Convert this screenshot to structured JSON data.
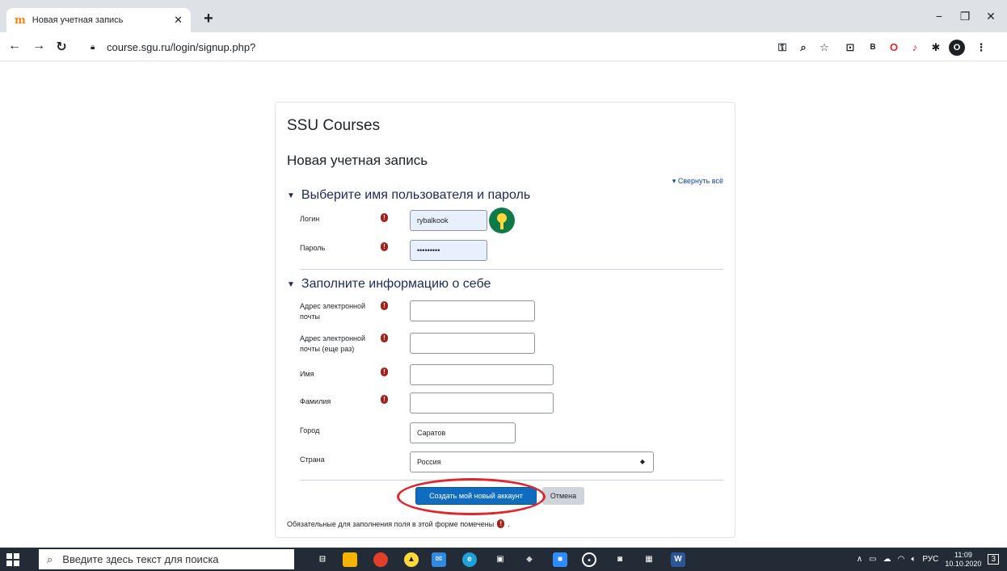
{
  "browser": {
    "tab_title": "Новая учетная запись",
    "url": "course.sgu.ru/login/signup.php?"
  },
  "page": {
    "site_title": "SSU Courses",
    "heading": "Новая учетная запись",
    "collapse_all": "Свернуть всё",
    "section1_title": "Выберите имя пользователя и пароль",
    "section2_title": "Заполните информацию о себе",
    "fields": {
      "login": {
        "label": "Логин",
        "value": "rybalkook"
      },
      "password": {
        "label": "Пароль",
        "value": "•••••••••"
      },
      "email_label_1": "Адрес электронной",
      "email_label_2": "почты",
      "email2_label_1": "Адрес электронной",
      "email2_label_2": "почты (еще раз)",
      "firstname": {
        "label": "Имя"
      },
      "lastname": {
        "label": "Фамилия"
      },
      "city": {
        "label": "Город",
        "value": "Саратов"
      },
      "country": {
        "label": "Страна",
        "value": "Россия"
      }
    },
    "submit_label": "Создать мой новый аккаунт",
    "cancel_label": "Отмена",
    "required_note": "Обязательные для заполнения поля в этой форме помечены",
    "required_note_end": "."
  },
  "taskbar": {
    "search_placeholder": "Введите здесь текст для поиска",
    "lang": "РУС",
    "time": "11:09",
    "date": "10.10.2020",
    "notifications": "3"
  },
  "colors": {
    "primary": "#0f6cbf",
    "required": "#a5211b",
    "annotation": "#e0262a"
  }
}
